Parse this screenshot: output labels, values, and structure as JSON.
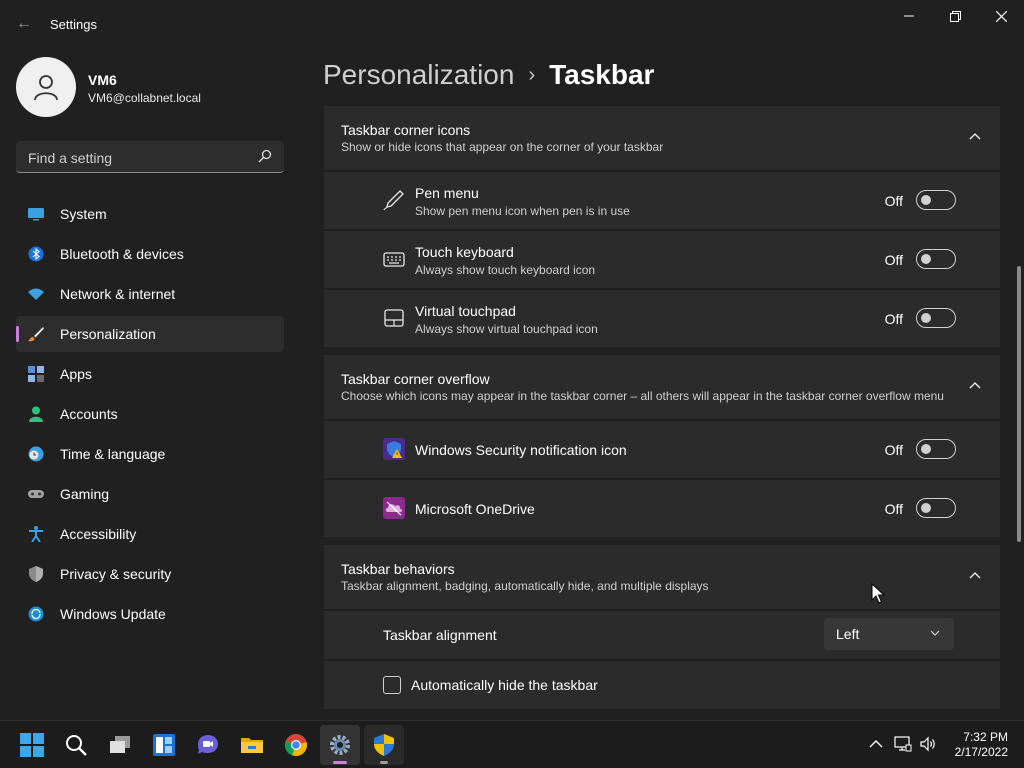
{
  "window": {
    "title": "Settings",
    "controls": {
      "minimize": "—",
      "maximize": "❐",
      "close": "✕"
    }
  },
  "user": {
    "name": "VM6",
    "email": "VM6@collabnet.local"
  },
  "search": {
    "placeholder": "Find a setting"
  },
  "nav": {
    "items": [
      {
        "label": "System",
        "icon": "monitor-icon"
      },
      {
        "label": "Bluetooth & devices",
        "icon": "bluetooth-icon"
      },
      {
        "label": "Network & internet",
        "icon": "wifi-icon"
      },
      {
        "label": "Personalization",
        "icon": "brush-icon",
        "selected": true
      },
      {
        "label": "Apps",
        "icon": "apps-icon"
      },
      {
        "label": "Accounts",
        "icon": "person-icon"
      },
      {
        "label": "Time & language",
        "icon": "clock-globe-icon"
      },
      {
        "label": "Gaming",
        "icon": "gamepad-icon"
      },
      {
        "label": "Accessibility",
        "icon": "accessibility-icon"
      },
      {
        "label": "Privacy & security",
        "icon": "shield-icon"
      },
      {
        "label": "Windows Update",
        "icon": "update-icon"
      }
    ]
  },
  "breadcrumb": {
    "parent": "Personalization",
    "separator": "›",
    "current": "Taskbar"
  },
  "sections": {
    "corner_icons": {
      "title": "Taskbar corner icons",
      "subtitle": "Show or hide icons that appear on the corner of your taskbar",
      "rows": [
        {
          "title": "Pen menu",
          "subtitle": "Show pen menu icon when pen is in use",
          "state": "Off",
          "icon": "pen-icon"
        },
        {
          "title": "Touch keyboard",
          "subtitle": "Always show touch keyboard icon",
          "state": "Off",
          "icon": "keyboard-icon"
        },
        {
          "title": "Virtual touchpad",
          "subtitle": "Always show virtual touchpad icon",
          "state": "Off",
          "icon": "touchpad-icon"
        }
      ]
    },
    "corner_overflow": {
      "title": "Taskbar corner overflow",
      "subtitle": "Choose which icons may appear in the taskbar corner – all others will appear in the taskbar corner overflow menu",
      "rows": [
        {
          "title": "Windows Security notification icon",
          "state": "Off",
          "icon": "windows-security-icon"
        },
        {
          "title": "Microsoft OneDrive",
          "state": "Off",
          "icon": "onedrive-icon"
        }
      ]
    },
    "behaviors": {
      "title": "Taskbar behaviors",
      "subtitle": "Taskbar alignment, badging, automatically hide, and multiple displays",
      "alignment_label": "Taskbar alignment",
      "alignment_value": "Left",
      "autohide_label": "Automatically hide the taskbar"
    }
  },
  "taskbar": {
    "apps": [
      "start-icon",
      "search-icon",
      "task-view-icon",
      "widgets-icon",
      "teams-chat-icon",
      "file-explorer-icon",
      "chrome-icon",
      "settings-icon",
      "windows-security-icon"
    ],
    "clock": {
      "time": "7:32 PM",
      "date": "2/17/2022"
    }
  },
  "colors": {
    "accent": "#c880d8",
    "background": "#202020",
    "card": "#2b2b2b"
  }
}
